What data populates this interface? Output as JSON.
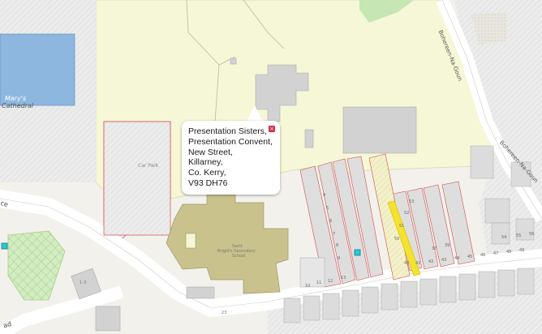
{
  "map": {
    "labels": {
      "cathedral_1": "Mary's",
      "cathedral_2": "Cathedral",
      "car_park": "Car Park",
      "school_1": "Saint",
      "school_2": "Brigid's Secondary",
      "school_3": "School",
      "road_top": "Bohereen-Na-Goun",
      "road_right": "Bohereen-Na-Goun",
      "road_left_1": "ce",
      "road_left_2": "ad",
      "house_a": "1-3",
      "number_bottom": "23"
    },
    "house_numbers": [
      "4",
      "5",
      "6",
      "7",
      "8",
      "9",
      "10",
      "11",
      "12",
      "13",
      "37",
      "39",
      "40",
      "41",
      "42",
      "43",
      "44",
      "45",
      "46",
      "47",
      "48",
      "49",
      "50",
      "51",
      "52",
      "53",
      "54",
      "55",
      "56"
    ],
    "colors": {
      "background": "#f3f1ec",
      "greenfield": "#f6f7d6",
      "building_grey": "#d2d2d2",
      "school": "#c9c28d",
      "water": "#8eb7e0",
      "park": "#c6e6b4",
      "highlight": "#f4e233",
      "boundary": "#d24b4b",
      "marker": "#2dc6d8"
    }
  },
  "popup": {
    "close_symbol": "×",
    "address_lines": [
      "Presentation Sisters,",
      "Presentation Convent,",
      "New Street,",
      "Killarney,",
      "Co. Kerry,",
      "V93 DH76"
    ]
  }
}
